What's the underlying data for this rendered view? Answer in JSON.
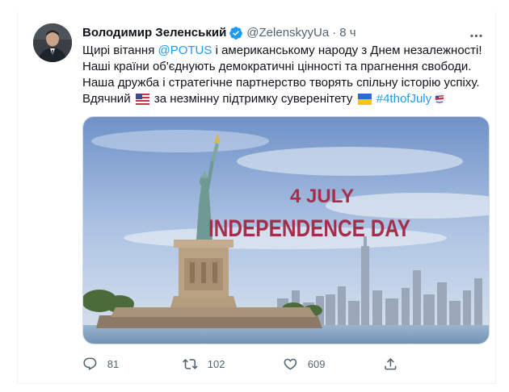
{
  "tweet": {
    "display_name": "Володимир Зеленський",
    "handle": "@ZelenskyyUa",
    "separator": "·",
    "time": "8 ч",
    "text": {
      "line1_part1": "Щирі вітання ",
      "line1_mention": "@POTUS",
      "line1_part2": " і американському народу з Днем незалежності!",
      "line2": "Наші країни об'єднують демократичні цінності та прагнення свободи.",
      "line3": "Наша дружба і стратегічне партнерство творять спільну історію успіху.",
      "line4_part1": "Вдячний ",
      "line4_part2": " за незмінну підтримку суверенітету ",
      "line4_hashtag": "#4thofJuly"
    },
    "media": {
      "headline": "4 JULY",
      "subheadline": "INDEPENDENCE DAY"
    },
    "stats": {
      "replies": "81",
      "retweets": "102",
      "likes": "609"
    }
  },
  "colors": {
    "link": "#1d9bf0",
    "secondary_text": "#536471",
    "headline": "#a3304a",
    "verified": "#1d9bf0"
  },
  "icons": [
    "avatar",
    "verified-icon",
    "more-icon",
    "us-flag-icon",
    "ukraine-flag-icon",
    "hashtag-emoji-icon",
    "reply-icon",
    "retweet-icon",
    "like-icon",
    "share-icon"
  ]
}
